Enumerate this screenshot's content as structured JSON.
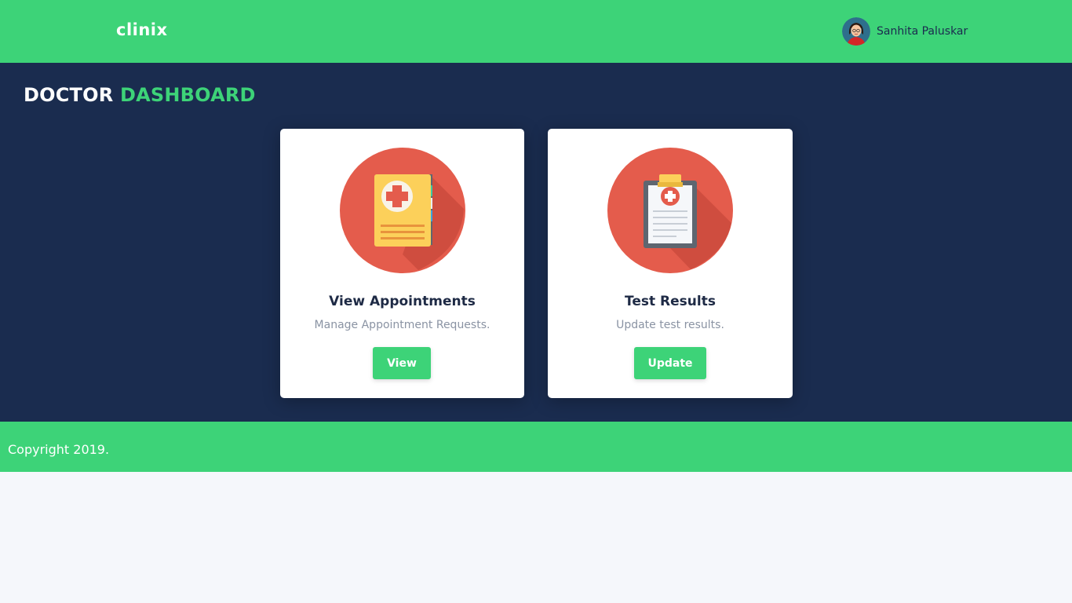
{
  "header": {
    "logo": "clinix",
    "user_name": "Sanhita Paluskar"
  },
  "page": {
    "title_part1": "DOCTOR",
    "title_part2": "DASHBOARD"
  },
  "cards": [
    {
      "title": "View Appointments",
      "description": "Manage Appointment Requests.",
      "button_label": "View",
      "icon": "medical-book-icon"
    },
    {
      "title": "Test Results",
      "description": "Update test results.",
      "button_label": "Update",
      "icon": "medical-clipboard-icon"
    }
  ],
  "footer": {
    "copyright": "Copyright 2019."
  },
  "colors": {
    "brand_green": "#3dd378",
    "navy": "#1a2c4f",
    "icon_circle": "#e45c4c"
  }
}
